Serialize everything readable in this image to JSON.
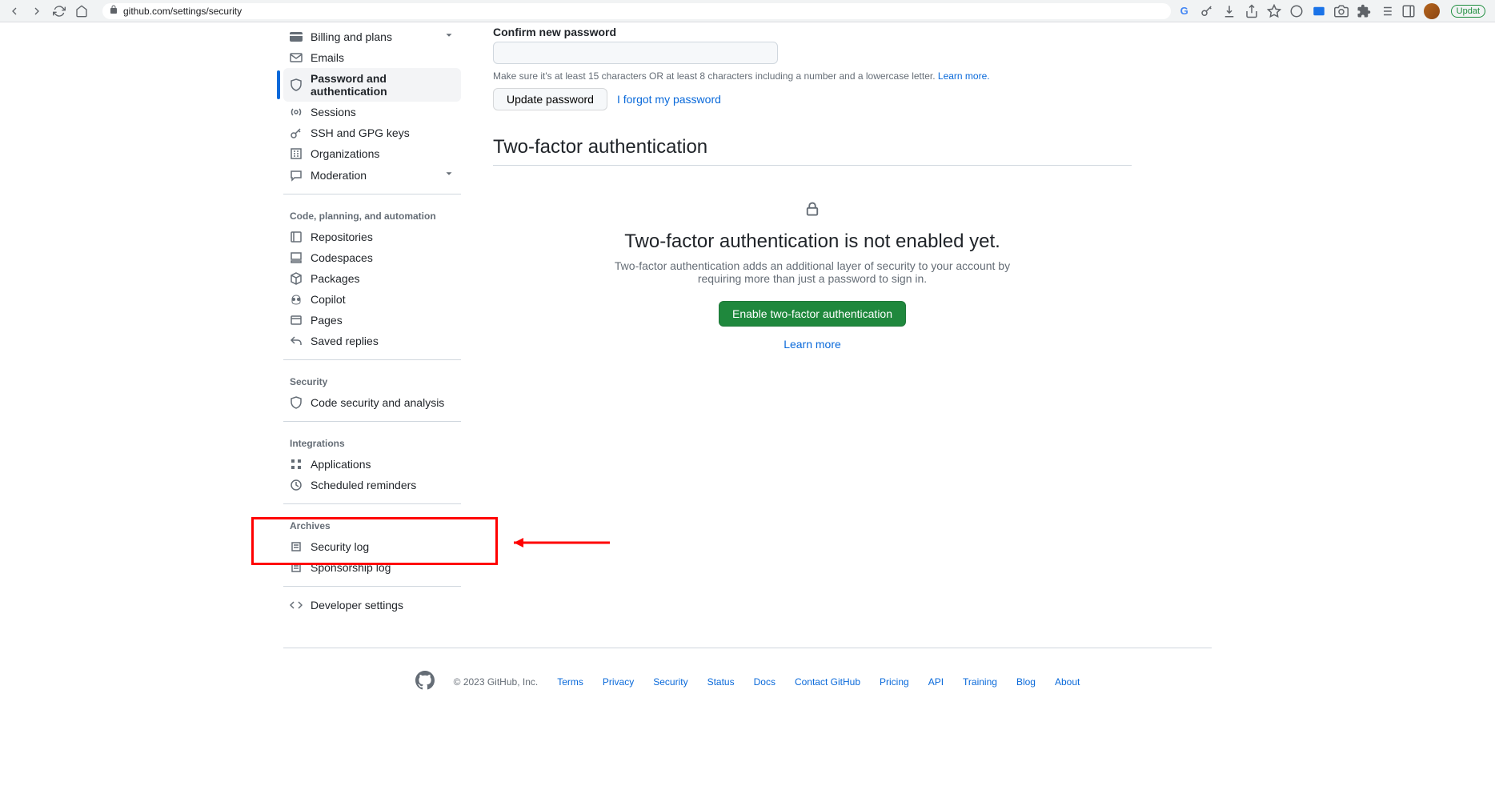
{
  "browser": {
    "url": "github.com/settings/security",
    "update_label": "Updat"
  },
  "sidebar": {
    "items_top": [
      {
        "label": "Billing and plans",
        "icon": "credit-card",
        "chevron": true
      },
      {
        "label": "Emails",
        "icon": "mail"
      },
      {
        "label": "Password and authentication",
        "icon": "shield-lock",
        "active": true
      },
      {
        "label": "Sessions",
        "icon": "broadcast"
      },
      {
        "label": "SSH and GPG keys",
        "icon": "key"
      },
      {
        "label": "Organizations",
        "icon": "organization"
      },
      {
        "label": "Moderation",
        "icon": "comment",
        "chevron": true
      }
    ],
    "group_code_heading": "Code, planning, and automation",
    "items_code": [
      {
        "label": "Repositories",
        "icon": "repo"
      },
      {
        "label": "Codespaces",
        "icon": "codespaces"
      },
      {
        "label": "Packages",
        "icon": "package"
      },
      {
        "label": "Copilot",
        "icon": "copilot"
      },
      {
        "label": "Pages",
        "icon": "browser"
      },
      {
        "label": "Saved replies",
        "icon": "reply"
      }
    ],
    "group_security_heading": "Security",
    "items_security": [
      {
        "label": "Code security and analysis",
        "icon": "shield"
      }
    ],
    "group_integrations_heading": "Integrations",
    "items_integrations": [
      {
        "label": "Applications",
        "icon": "apps"
      },
      {
        "label": "Scheduled reminders",
        "icon": "clock"
      }
    ],
    "group_archives_heading": "Archives",
    "items_archives": [
      {
        "label": "Security log",
        "icon": "log"
      },
      {
        "label": "Sponsorship log",
        "icon": "log"
      }
    ],
    "developer_settings": "Developer settings"
  },
  "content": {
    "confirm_label": "Confirm new password",
    "help_text": "Make sure it's at least 15 characters OR at least 8 characters including a number and a lowercase letter. ",
    "help_link": "Learn more.",
    "update_btn": "Update password",
    "forgot_link": "I forgot my password",
    "tfa_title": "Two-factor authentication",
    "tfa_heading": "Two-factor authentication is not enabled yet.",
    "tfa_desc": "Two-factor authentication adds an additional layer of security to your account by requiring more than just a password to sign in.",
    "tfa_enable_btn": "Enable two-factor authentication",
    "tfa_learn": "Learn more"
  },
  "footer": {
    "copy": "© 2023 GitHub, Inc.",
    "links": [
      "Terms",
      "Privacy",
      "Security",
      "Status",
      "Docs",
      "Contact GitHub",
      "Pricing",
      "API",
      "Training",
      "Blog",
      "About"
    ]
  }
}
